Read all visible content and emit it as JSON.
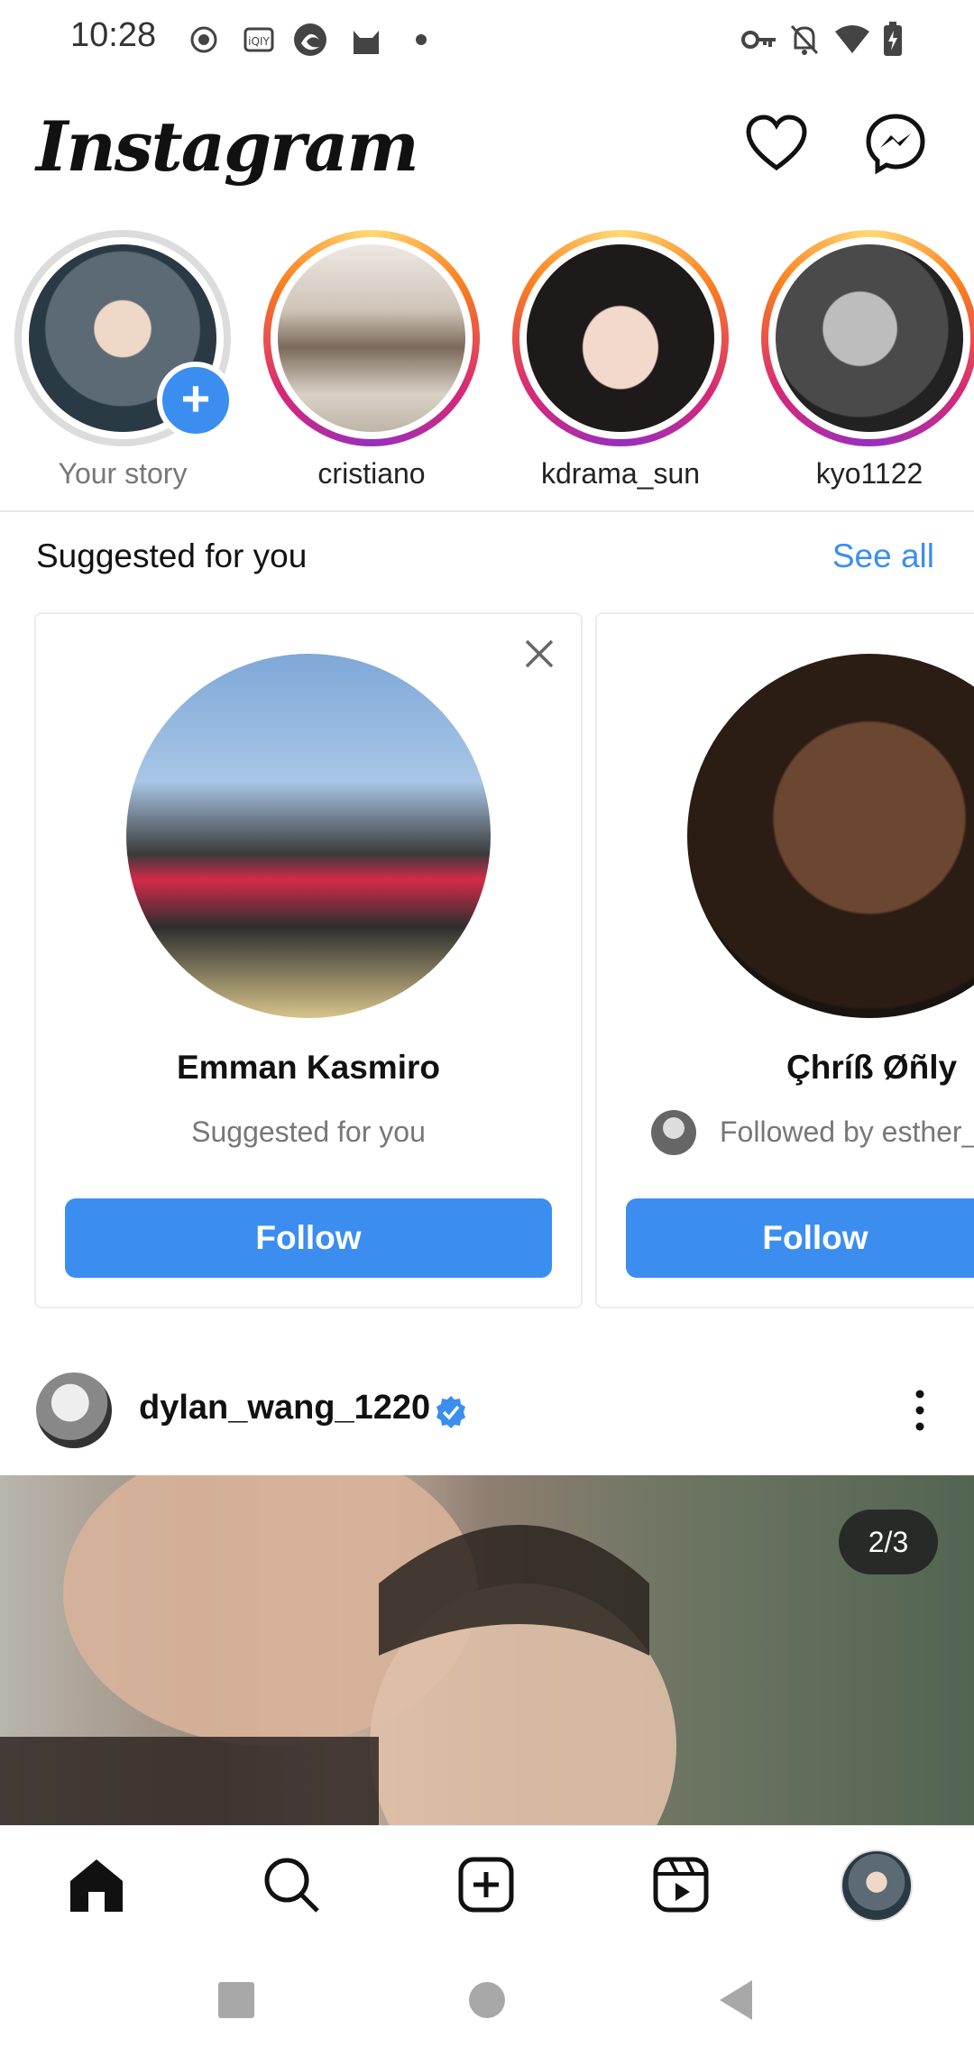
{
  "status_bar": {
    "time": "10:28",
    "left_icons": [
      "record-icon",
      "iqiyi-icon",
      "edge-icon",
      "cat-icon",
      "dot-icon"
    ],
    "right_icons": [
      "vpn-key-icon",
      "muted-bell-icon",
      "wifi-icon",
      "battery-charging-icon"
    ]
  },
  "header": {
    "logo": "Instagram",
    "icons": [
      "heart-icon",
      "messenger-icon"
    ]
  },
  "stories": [
    {
      "label": "Your story",
      "is_own": true
    },
    {
      "label": "cristiano"
    },
    {
      "label": "kdrama_sun"
    },
    {
      "label": "kyo1122"
    }
  ],
  "suggested": {
    "title": "Suggested for you",
    "see_all": "See all",
    "cards": [
      {
        "name": "Emman Kasmiro",
        "subtitle": "Suggested for you",
        "button": "Follow"
      },
      {
        "name": "Çhríß Øñly",
        "subtitle": "Followed by esther_",
        "button": "Follow"
      }
    ]
  },
  "post": {
    "username": "dylan_wang_1220",
    "verified": true,
    "counter": "2/3"
  },
  "colors": {
    "accent": "#3b8ef0",
    "text": "#111111",
    "muted": "#777777"
  }
}
